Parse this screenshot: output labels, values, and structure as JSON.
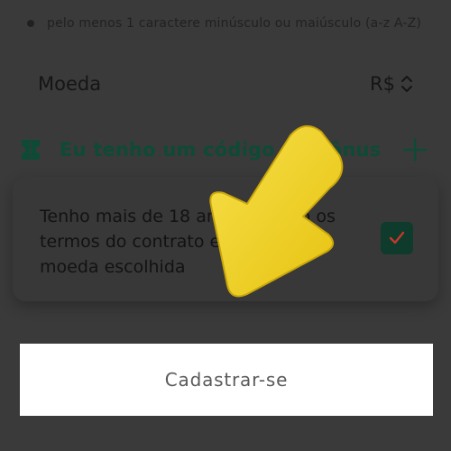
{
  "password_rules": {
    "rule": "pelo menos 1 caractere minúsculo ou maiúsculo (a-z A-Z)"
  },
  "currency": {
    "label": "Moeda",
    "value": "R$"
  },
  "promo": {
    "label": "Eu tenho um código de bônus"
  },
  "terms": {
    "text": "Tenho mais de 18 anos e aceito os termos do contrato e escolho a moeda escolhida",
    "checked": true
  },
  "signup": {
    "label": "Cadastrar-se"
  },
  "colors": {
    "background": "#3a3a3a",
    "accent": "#0e4a36",
    "arrow": "#f2d21f"
  },
  "icons": {
    "currency_selector": "updown-chevron-icon",
    "promo": "ticket-icon",
    "expand": "plus-icon",
    "checkbox": "check-icon",
    "overlay": "arrow-pointer-icon"
  }
}
